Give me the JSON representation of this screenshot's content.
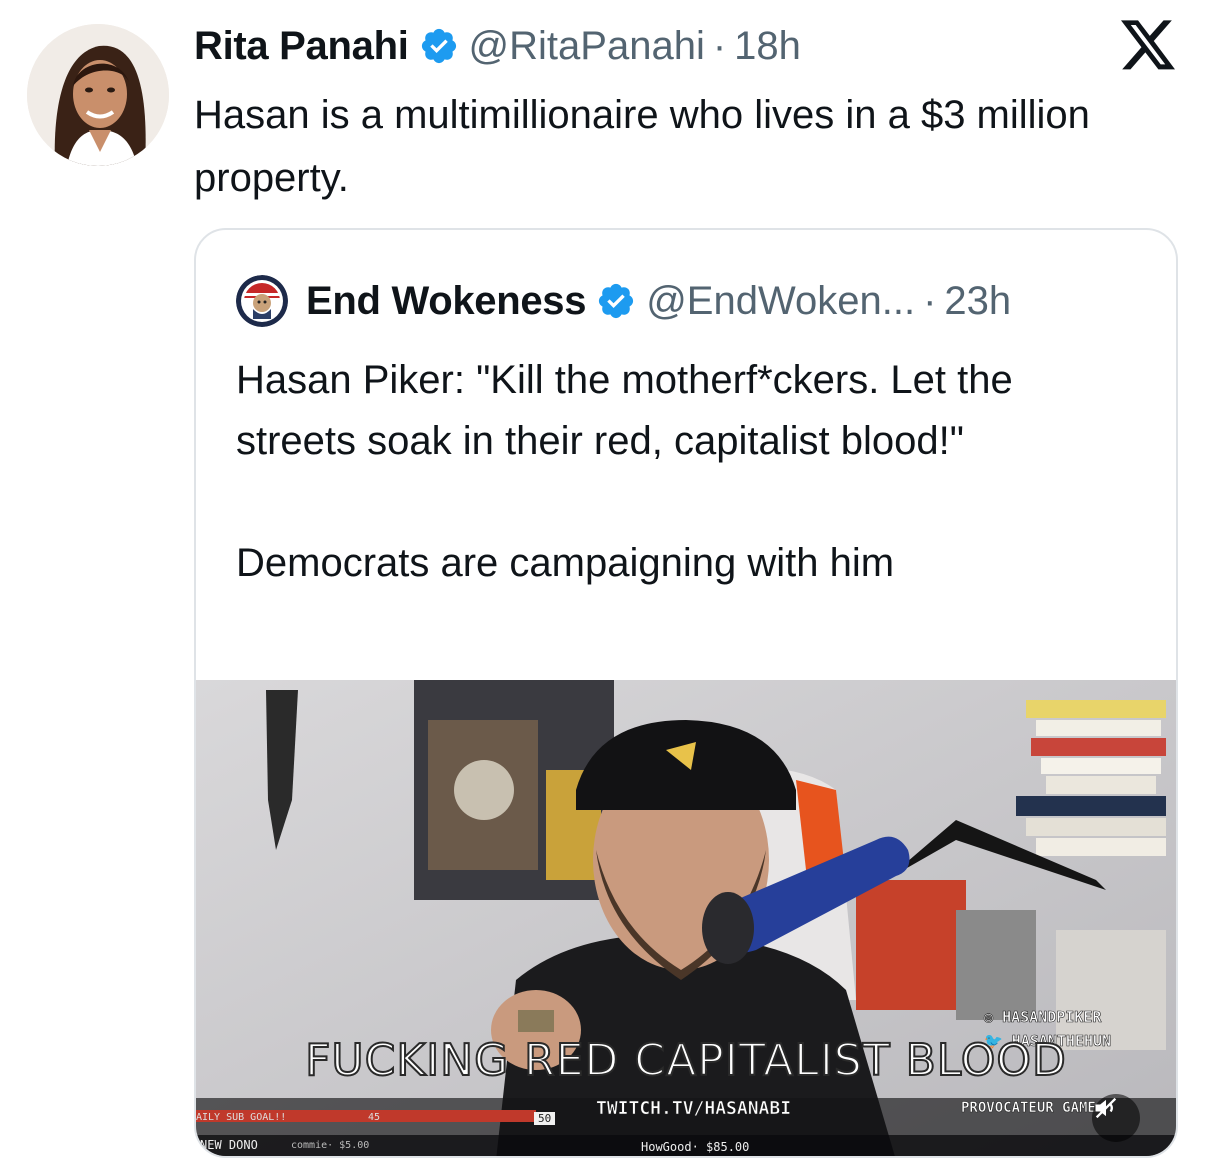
{
  "tweet": {
    "author_name": "Rita Panahi",
    "handle": "@RitaPanahi",
    "separator": "·",
    "time": "18h",
    "text": "Hasan is a multimillionaire who lives in a $3 million property."
  },
  "quoted": {
    "author_name": "End Wokeness",
    "handle": "@EndWoken...",
    "separator": "·",
    "time": "23h",
    "paragraphs": [
      "Hasan Piker: \"Kill the motherf*ckers. Let the streets soak in their red, capitalist blood!\"",
      "Democrats are campaigning with him"
    ],
    "video": {
      "caption": "FUCKING RED CAPITALIST BLOOD",
      "instagram": "HASANDPIKER",
      "twitter": "HASANTHEHUN",
      "twitch": "TWITCH.TV/HASANABI",
      "provocateur": "PROVOCATEUR GAME",
      "sub_goal_label": "AILY SUB GOAL!!",
      "sub_goal_mid": "45",
      "sub_goal_target": "50",
      "new_dono": "NEW DONO",
      "commie": "commie· $5.00",
      "howgood": "HowGood· $85.00",
      "muted": true
    }
  },
  "colors": {
    "verified": "#1d9bf0",
    "text": "#0f1419",
    "secondary": "#536471",
    "border": "#dfe3e7"
  },
  "icons": {
    "verified": "verified-badge-icon",
    "x_logo": "x-logo-icon",
    "mute": "muted-speaker-icon"
  }
}
